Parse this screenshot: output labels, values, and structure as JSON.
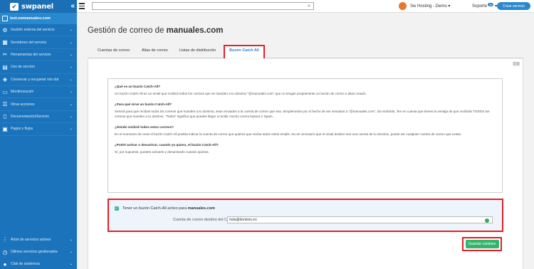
{
  "app": {
    "logo_text": "swpanel",
    "collapse_glyph": "«"
  },
  "sidebar": {
    "domain": "test.swmanuales.com",
    "items": [
      {
        "label": "Gestión externa del servicio",
        "icon": "gear-icon"
      },
      {
        "label": "Servidores del servicio",
        "icon": "server-icon"
      },
      {
        "label": "Herramientas del servicio",
        "icon": "tools-icon"
      },
      {
        "label": "Uso de servicio",
        "icon": "chart-icon"
      },
      {
        "label": "Conservar y recuperar mis dat",
        "icon": "shield-icon"
      },
      {
        "label": "Monitorización",
        "icon": "monitor-icon"
      },
      {
        "label": "Otras acciones",
        "icon": "list-icon"
      },
      {
        "label": "Documentación/Servicio",
        "icon": "document-icon"
      },
      {
        "label": "Pagos y flujos",
        "icon": "payment-icon"
      }
    ],
    "bottom_items": [
      {
        "label": "Árbol de servicios activos",
        "icon": "tree-icon"
      },
      {
        "label": "Últimos servicios gestionados",
        "icon": "history-icon"
      },
      {
        "label": "Club de asistencia",
        "icon": "club-icon"
      }
    ]
  },
  "topbar": {
    "search_placeholder": "",
    "account": "Sw Hosting - Demo",
    "support": "Soporte",
    "support_badge": "10",
    "create_button": "Crear servicio",
    "brand_color": "#1a73bb"
  },
  "page": {
    "title_prefix": "Gestión de correo de ",
    "title_domain": "manuales.com"
  },
  "tabs": [
    {
      "label": "Cuentas de correo"
    },
    {
      "label": "Alias de correo"
    },
    {
      "label": "Listas de distribución"
    },
    {
      "label": "Buzón Catch All",
      "active": true
    }
  ],
  "faq": [
    {
      "q": "¿Qué es un buzón Catch-All?",
      "a": "Un buzón Catch-All es un email que recibirá todos los correos que se manden a tu dominio \"@manuales.com\" que no tengan propiamente un buzón de correo o alias creado."
    },
    {
      "q": "¿Para qué sirve un buzón Catch-All?",
      "a": "Servirá para que recibas todos los correos que manden a tu dominio, sean enviados a la cuenta de correo que sea. Simplemente por el hecho de ser enviados a \"@manuales.com\", los recibirás. Ten en cuenta que tienes la ventaja de que recibirás TODOS los correos que manden a tu dominio. \"Todos\" significa que puedes llegar a recibir mucho correo basura o Spam."
    },
    {
      "q": "¿Dónde recibiré todos estos correos?",
      "a": "En el momento de crear el buzón Catch-All podrás indicar la cuenta de correo que quieres que reciba todos estos emails. No es necesario que el email destino sea una cuenta de tu dominio, puede ser cualquier cuenta de correo que exista."
    },
    {
      "q": "¿Podré activar o desactivar, cuando yo quiera, el buzón Catch-All?",
      "a": "Sí, por supuesto, puedes activarlo y desactivarlo cuando quieras."
    }
  ],
  "form": {
    "checkbox_label_prefix": "Tener un buzón Catch-All activo para ",
    "checkbox_domain": "manuales.com",
    "checked": true,
    "field_label": "Cuenta de correo destino del Catch-All",
    "field_value": "hola@dominio.es",
    "save_label": "Guardar cambios"
  }
}
